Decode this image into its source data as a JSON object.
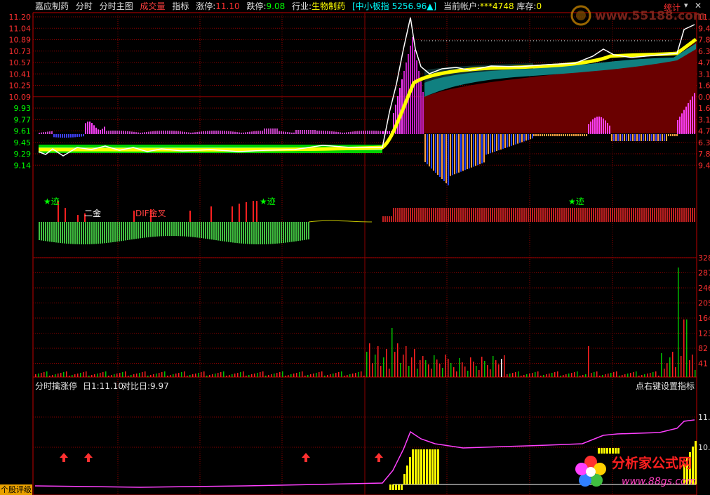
{
  "header": {
    "stock_name": "嘉应制药",
    "menu": [
      "分时",
      "分时主图",
      "成交量",
      "指标"
    ],
    "limit_up_label": "涨停:",
    "limit_up_value": "11.10",
    "limit_down_label": "跌停:",
    "limit_down_value": "9.08",
    "industry_label": "行业:",
    "industry_value": "生物制药",
    "index_label": "[中小板指",
    "index_value": "5256.96",
    "account_label": "当前帐户:",
    "account_value": "***4748",
    "stock_label": "库存:",
    "stock_value": "0",
    "stats_label": "统计"
  },
  "price_axis_left": [
    "11.20",
    "11.04",
    "10.89",
    "10.73",
    "10.57",
    "10.41",
    "10.25",
    "10.09",
    "9.93",
    "9.77",
    "9.61",
    "9.45",
    "9.29",
    "9.14"
  ],
  "price_axis_right": [
    "11.0",
    "9.4",
    "7.8",
    "6.3",
    "4.7",
    "3.1",
    "1.6",
    "0.0",
    "1.6",
    "3.1",
    "4.7",
    "6.3",
    "7.8",
    "9.4"
  ],
  "volume_axis_right": [
    "328",
    "287",
    "246",
    "205",
    "164",
    "123",
    "82",
    "41"
  ],
  "indicator_labels": {
    "trace_1": "★迹",
    "trace_2": "★迹",
    "trace_3": "★迹",
    "second_gold": "二金",
    "dif_cross": "DIF金叉"
  },
  "sub_panel": {
    "title": "分时擒涨停",
    "day_label": "日1:11.10",
    "compare_label": "对比日:9.97",
    "right_hint": "点右键设置指标",
    "axis_right": [
      "11.",
      "10."
    ]
  },
  "badge": "个股评级",
  "watermark_top": "www.55188.com",
  "watermark_bottom_title": "分析家公式网",
  "watermark_bottom_url": "www.88gs.com",
  "colors": {
    "grid": "#8b0000",
    "up": "#ff2020",
    "down": "#00c000",
    "price_line": "#ffffff",
    "avg_line": "#ffff00",
    "axis_text": "#ff3030",
    "green_text": "#00ff00",
    "magenta": "#ff40ff"
  }
}
